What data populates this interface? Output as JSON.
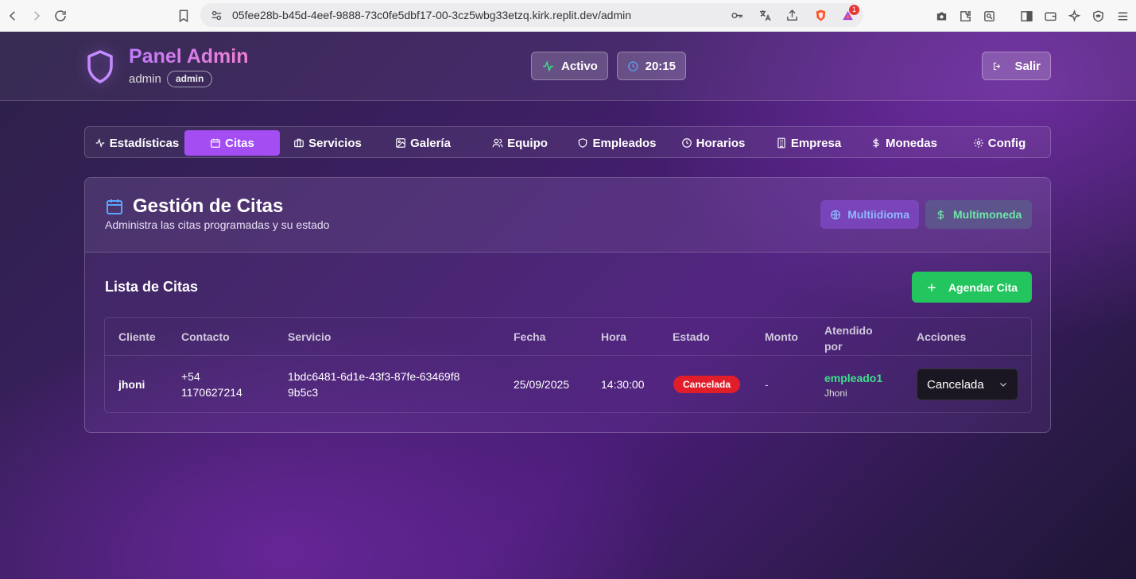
{
  "browser": {
    "url": "05fee28b-b45d-4eef-9888-73c0fe5dbf17-00-3cz5wbg33etzq.kirk.replit.dev/admin",
    "brave_badge_count": "1"
  },
  "header": {
    "title": "Panel Admin",
    "user_name": "admin",
    "role_badge": "admin",
    "status_label": "Activo",
    "clock": "20:15",
    "logout_label": "Salir",
    "colors": {
      "status_icon": "#3ee08a",
      "clock_icon": "#5aa6ff"
    }
  },
  "tabs": [
    {
      "label": "Estadísticas",
      "icon": "activity-icon",
      "active": false
    },
    {
      "label": "Citas",
      "icon": "calendar-icon",
      "active": true
    },
    {
      "label": "Servicios",
      "icon": "briefcase-icon",
      "active": false
    },
    {
      "label": "Galería",
      "icon": "image-icon",
      "active": false
    },
    {
      "label": "Equipo",
      "icon": "users-icon",
      "active": false
    },
    {
      "label": "Empleados",
      "icon": "shield-icon",
      "active": false
    },
    {
      "label": "Horarios",
      "icon": "clock-icon",
      "active": false
    },
    {
      "label": "Empresa",
      "icon": "building-icon",
      "active": false
    },
    {
      "label": "Monedas",
      "icon": "dollar-icon",
      "active": false
    },
    {
      "label": "Config",
      "icon": "gear-icon",
      "active": false
    }
  ],
  "section": {
    "title": "Gestión de Citas",
    "subtitle": "Administra las citas programadas y su estado",
    "multilang_label": "Multiidioma",
    "multicurrency_label": "Multimoneda",
    "list_title": "Lista de Citas",
    "add_button": "Agendar Cita"
  },
  "table": {
    "headers": [
      "Cliente",
      "Contacto",
      "Servicio",
      "Fecha",
      "Hora",
      "Estado",
      "Monto",
      "Atendido por",
      "Acciones"
    ],
    "rows": [
      {
        "cliente": "jhoni",
        "contacto": "+54 1170627214",
        "servicio": "1bdc6481-6d1e-43f3-87fe-63469f89b5c3",
        "fecha": "25/09/2025",
        "hora": "14:30:00",
        "estado": "Cancelada",
        "monto": "-",
        "atendido_user": "empleado1",
        "atendido_name": "Jhoni",
        "accion": "Cancelada"
      }
    ]
  },
  "colors": {
    "accent": "#a34df2",
    "success": "#22c55e",
    "danger": "#e11d2a",
    "employee_link": "#3ee08a"
  }
}
